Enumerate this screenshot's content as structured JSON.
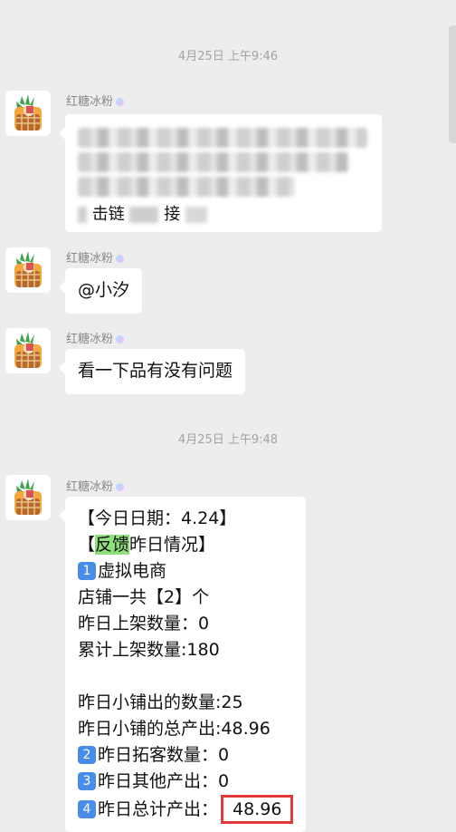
{
  "timestamps": [
    "4月25日 上午9:46",
    "4月25日 上午9:48"
  ],
  "sender": "红糖冰粉",
  "msg1": {
    "clickable_text": "击链",
    "tail_text": "接"
  },
  "msg2": {
    "text": "@小汐"
  },
  "msg3": {
    "text": "看一下品有没有问题"
  },
  "msg4": {
    "line1": "【今日日期：4.24】",
    "line2_prefix": "【",
    "line2_highlight": "反馈",
    "line2_suffix": "昨日情况】",
    "section1_num": "1",
    "section1_title": "虚拟电商",
    "stores": "店铺一共【2】个",
    "listed_yesterday": "昨日上架数量：0",
    "listed_total": "累计上架数量:180",
    "sold_count": "昨日小铺出的数量:25",
    "total_output": "昨日小铺的总产出:48.96",
    "section2_num": "2",
    "section2_text": "昨日拓客数量：0",
    "section3_num": "3",
    "section3_text": "昨日其他产出：0",
    "section4_num": "4",
    "section4_text": "昨日总计产出：",
    "section4_value": "48.96"
  },
  "colors": {
    "highlight": "#8fe07d",
    "badge": "#4a8de8",
    "redbox": "#e13b3b",
    "bg": "#ededed"
  }
}
